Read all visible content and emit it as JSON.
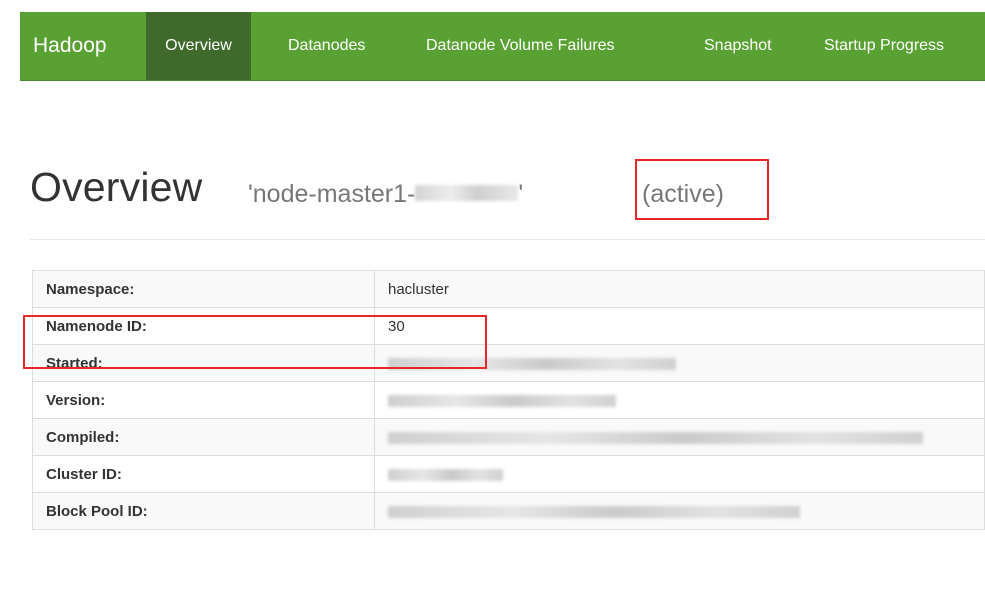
{
  "navbar": {
    "brand": "Hadoop",
    "items": [
      {
        "label": "Overview",
        "active": true
      },
      {
        "label": "Datanodes",
        "active": false
      },
      {
        "label": "Datanode Volume Failures",
        "active": false
      },
      {
        "label": "Snapshot",
        "active": false
      },
      {
        "label": "Startup Progress",
        "active": false
      }
    ]
  },
  "header": {
    "title": "Overview",
    "node_prefix": "'node-master1-",
    "node_suffix": "'",
    "state": "(active)"
  },
  "table": {
    "rows": [
      {
        "key": "Namespace:",
        "value": "hacluster"
      },
      {
        "key": "Namenode ID:",
        "value": "30"
      },
      {
        "key": "Started:",
        "value": ""
      },
      {
        "key": "Version:",
        "value": ""
      },
      {
        "key": "Compiled:",
        "value": ""
      },
      {
        "key": "Cluster ID:",
        "value": ""
      },
      {
        "key": "Block Pool ID:",
        "value": ""
      }
    ]
  },
  "colors": {
    "navbar": "#5aa134",
    "navbar_active": "#3f6a2b",
    "highlight": "#e8272a"
  }
}
